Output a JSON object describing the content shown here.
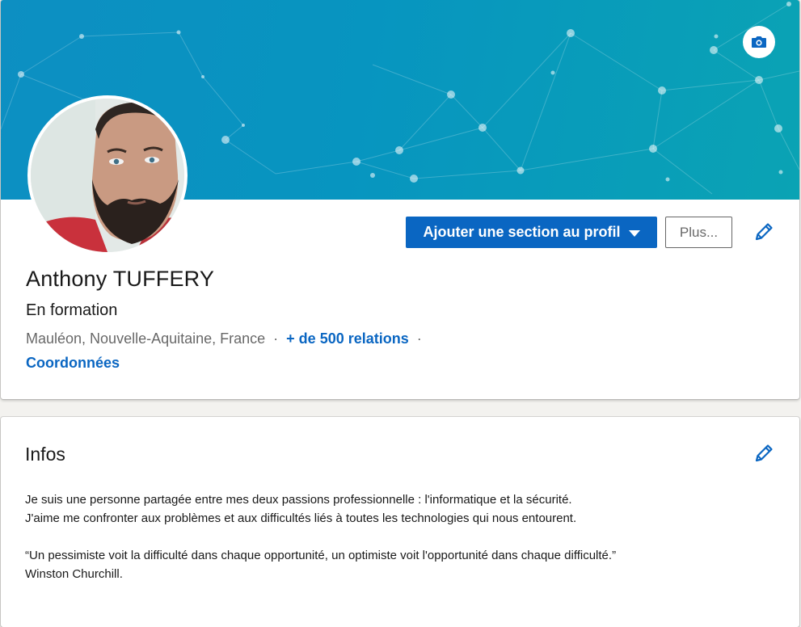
{
  "profile": {
    "name": "Anthony TUFFERY",
    "headline": "En formation",
    "location": "Mauléon, Nouvelle-Aquitaine, France",
    "separator": "·",
    "connections": "+ de 500 relations",
    "contact_info": "Coordonnées"
  },
  "actions": {
    "add_section_label": "Ajouter une section au profil",
    "more_label": "Plus..."
  },
  "about": {
    "title": "Infos",
    "line1": "Je suis une personne partagée entre mes deux passions professionnelle : l'informatique et la sécurité.",
    "line2": "J'aime me confronter aux problèmes et aux difficultés liés à toutes les technologies qui nous entourent.",
    "line3": "“Un pessimiste voit la difficulté dans chaque opportunité, un optimiste voit l'opportunité dans chaque difficulté.”",
    "line4": "Winston Churchill."
  },
  "icons": {
    "camera": "camera-icon",
    "edit": "pencil-icon",
    "caret": "caret-down-icon"
  },
  "colors": {
    "accent": "#0a66c2",
    "banner_start": "#0d8fc2",
    "banner_end": "#0aa3b4"
  }
}
